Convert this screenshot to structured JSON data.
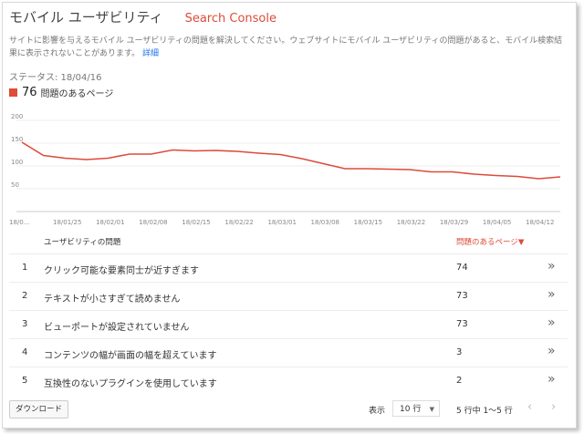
{
  "header": {
    "title": "モバイル ユーザビリティ",
    "brand": "Search Console"
  },
  "description": {
    "text": "サイトに影響を与えるモバイル ユーザビリティの問題を解決してください。ウェブサイトにモバイル ユーザビリティの問題があると、モバイル検索結果に表示されないことがあります。",
    "link": "詳細"
  },
  "status": "ステータス: 18/04/16",
  "summary": {
    "count": "76",
    "label": "問題のあるページ",
    "color": "#dd4b39"
  },
  "chart_data": {
    "type": "line",
    "y_ticks": [
      "200",
      "150",
      "100",
      "50"
    ],
    "ylim": [
      0,
      200
    ],
    "x_tick_labels": [
      "18/0...",
      "18/01/25",
      "18/02/01",
      "18/02/08",
      "18/02/15",
      "18/02/22",
      "18/03/01",
      "18/03/08",
      "18/03/15",
      "18/03/22",
      "18/03/29",
      "18/04/05",
      "18/04/12"
    ],
    "series": [
      {
        "color": "#dd4b39",
        "values": [
          152,
          123,
          117,
          114,
          117,
          126,
          126,
          135,
          133,
          134,
          132,
          128,
          125,
          116,
          105,
          94,
          94,
          93,
          92,
          87,
          87,
          82,
          79,
          77,
          72,
          76
        ]
      }
    ],
    "grid": true
  },
  "table": {
    "col_issue": "ユーザビリティの問題",
    "col_pages": "問題のあるページ▼",
    "rows": [
      {
        "num": "1",
        "issue": "クリック可能な要素同士が近すぎます",
        "pages": "74"
      },
      {
        "num": "2",
        "issue": "テキストが小さすぎて読めません",
        "pages": "73"
      },
      {
        "num": "3",
        "issue": "ビューポートが設定されていません",
        "pages": "73"
      },
      {
        "num": "4",
        "issue": "コンテンツの幅が画面の幅を超えています",
        "pages": "3"
      },
      {
        "num": "5",
        "issue": "互換性のないプラグインを使用しています",
        "pages": "2"
      }
    ],
    "row_arrow": "»"
  },
  "footer": {
    "download": "ダウンロード",
    "show_label": "表示",
    "rows_value": "10 行",
    "range": "5 行中 1〜5 行",
    "prev": "‹",
    "next": "›"
  }
}
